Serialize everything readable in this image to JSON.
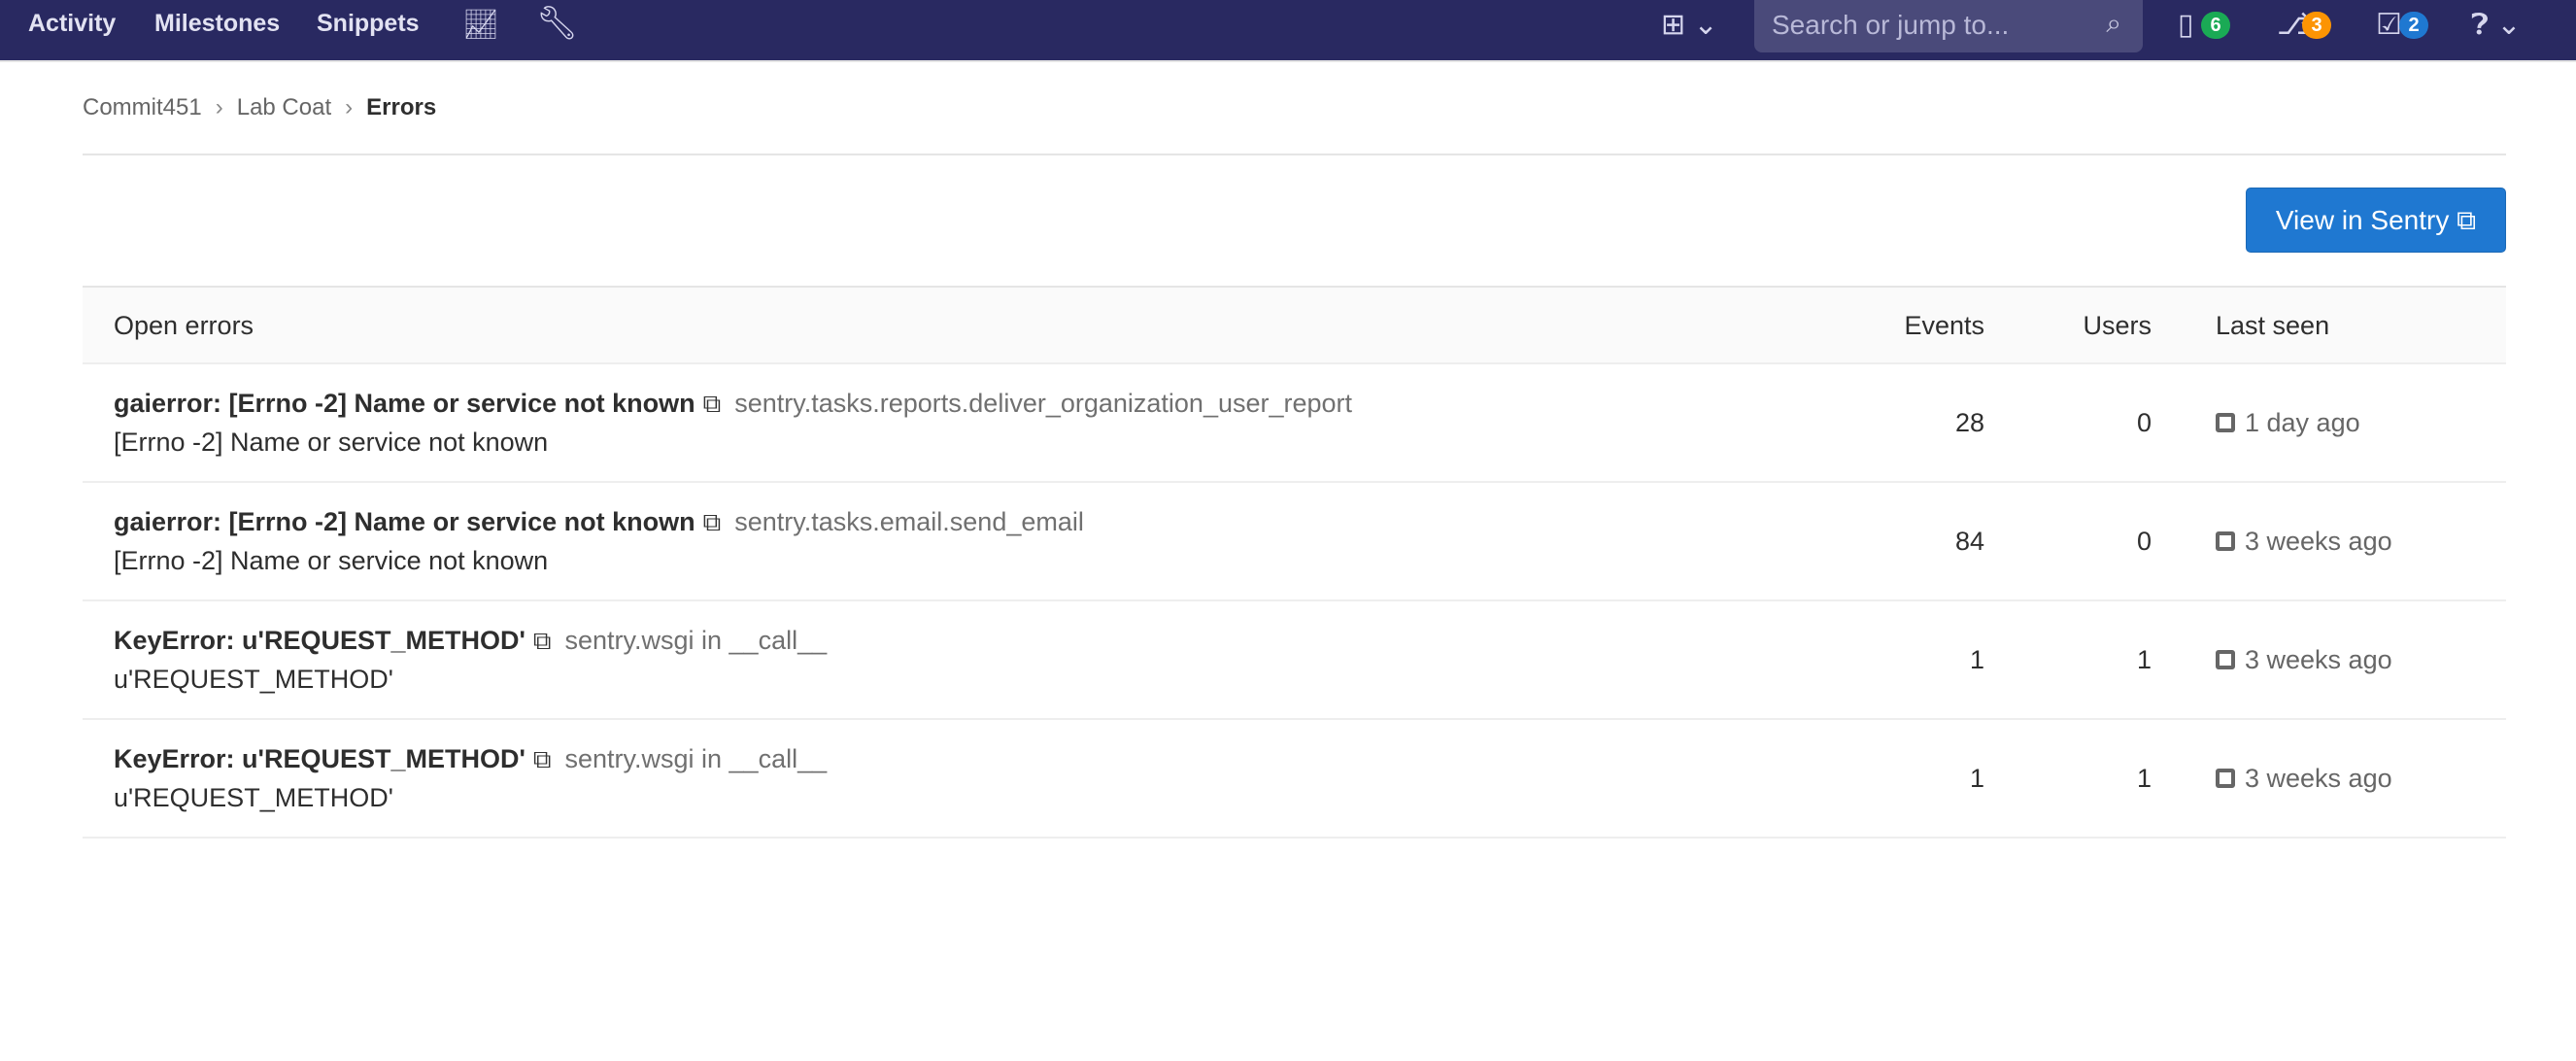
{
  "topbar": {
    "nav": [
      "Activity",
      "Milestones",
      "Snippets"
    ],
    "icons": [
      "chart-icon",
      "wrench-icon",
      "plus-square-icon",
      "issues-icon",
      "merge-request-icon",
      "todo-icon",
      "help-icon"
    ],
    "search_placeholder": "Search or jump to...",
    "issues_count": "6",
    "mr_count": "3",
    "todo_count": "2",
    "colors": {
      "bg": "#292961",
      "issues": "#1aaa55",
      "mr": "#fc9403",
      "todo": "#1f78d1"
    }
  },
  "breadcrumb": [
    "Commit451",
    "Lab Coat",
    "Errors"
  ],
  "view_button": "View in Sentry",
  "table": {
    "headers": {
      "title": "Open errors",
      "events": "Events",
      "users": "Users",
      "last_seen": "Last seen"
    },
    "rows": [
      {
        "title": "gaierror: [Errno -2] Name or service not known",
        "culprit": "sentry.tasks.reports.deliver_organization_user_report",
        "message": "[Errno -2] Name or service not known",
        "events": "28",
        "users": "0",
        "last_seen": "1 day ago"
      },
      {
        "title": "gaierror: [Errno -2] Name or service not known",
        "culprit": "sentry.tasks.email.send_email",
        "message": "[Errno -2] Name or service not known",
        "events": "84",
        "users": "0",
        "last_seen": "3 weeks ago"
      },
      {
        "title": "KeyError: u'REQUEST_METHOD'",
        "culprit": "sentry.wsgi in __call__",
        "message": "u'REQUEST_METHOD'",
        "events": "1",
        "users": "1",
        "last_seen": "3 weeks ago"
      },
      {
        "title": "KeyError: u'REQUEST_METHOD'",
        "culprit": "sentry.wsgi in __call__",
        "message": "u'REQUEST_METHOD'",
        "events": "1",
        "users": "1",
        "last_seen": "3 weeks ago"
      }
    ]
  }
}
